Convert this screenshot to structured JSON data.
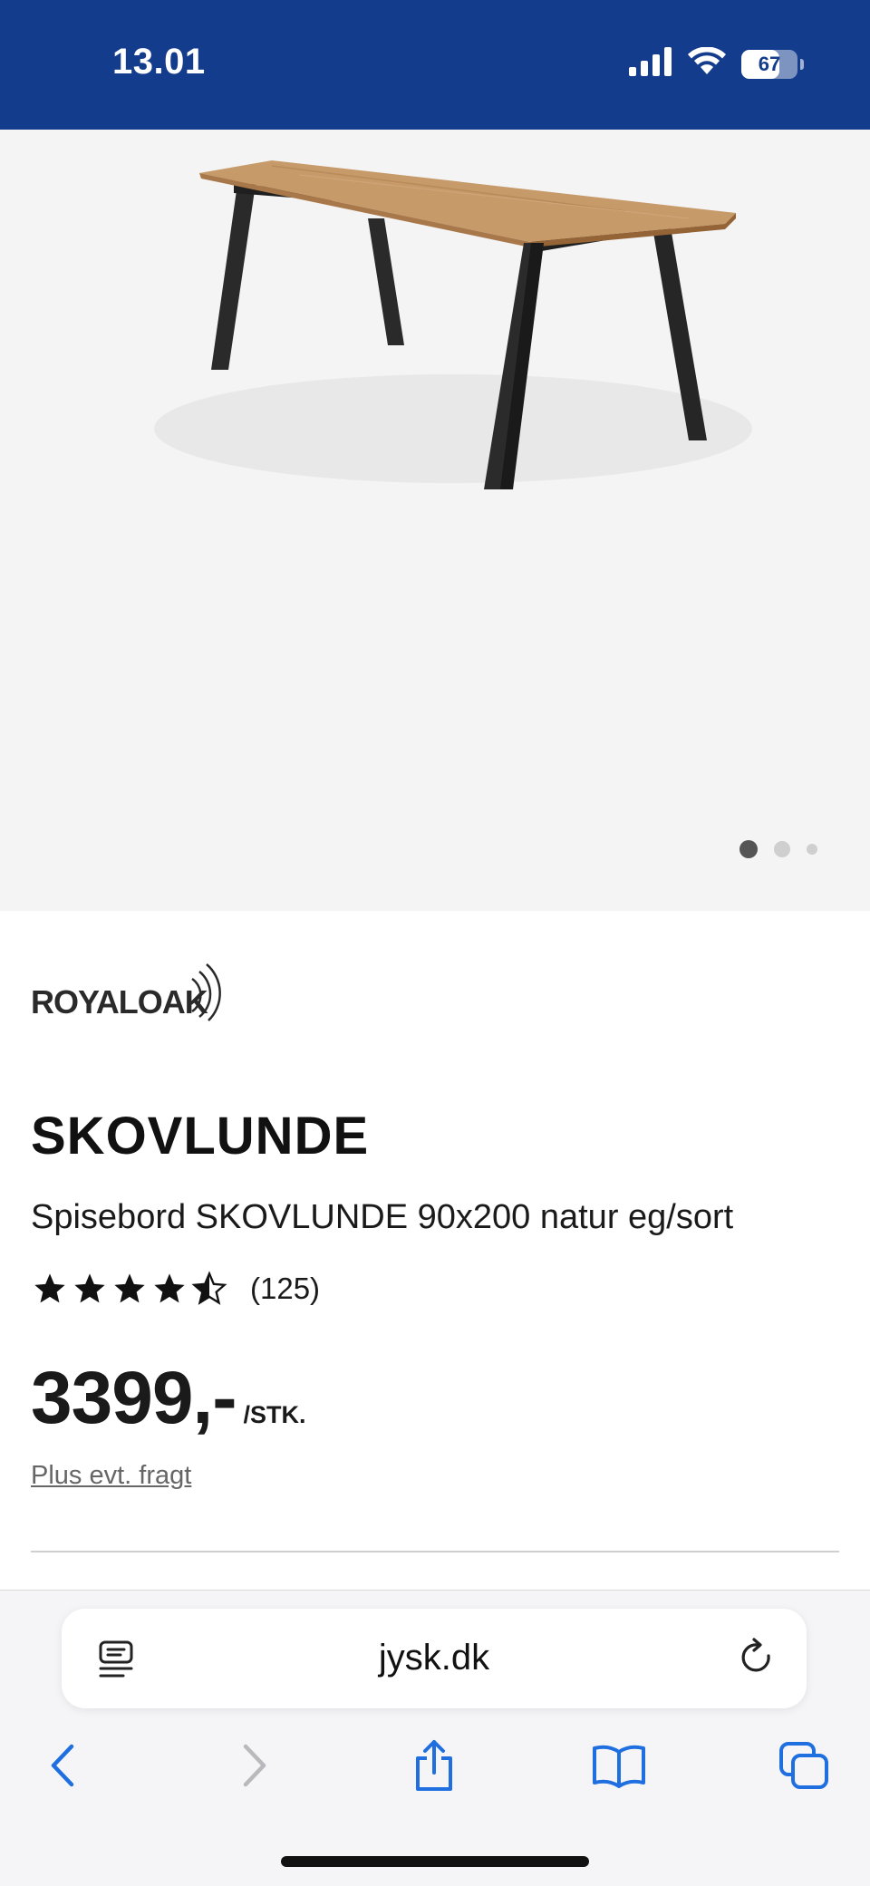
{
  "status_bar": {
    "time": "13.01",
    "battery_level": "67",
    "background_color": "#143c8c"
  },
  "gallery": {
    "image_subject": "dining table with oak top and black legs",
    "image_count": 3,
    "active_index": 0
  },
  "product": {
    "brand_logo_text": "ROYALOAK",
    "name": "SKOVLUNDE",
    "description": "Spisebord SKOVLUNDE 90x200 natur eg/sort",
    "rating": 4.5,
    "rating_max": 5,
    "review_count": "(125)",
    "price": "3399,-",
    "price_unit": "/STK.",
    "shipping_note": "Plus evt. fragt"
  },
  "browser": {
    "url": "jysk.dk",
    "icons": {
      "reader": "reader-mode-icon",
      "reload": "reload-icon",
      "back": "back-arrow-icon",
      "forward": "forward-arrow-icon",
      "share": "share-icon",
      "bookmarks": "bookmarks-icon",
      "tabs": "tabs-icon"
    },
    "accent_color": "#1f6fe0"
  }
}
